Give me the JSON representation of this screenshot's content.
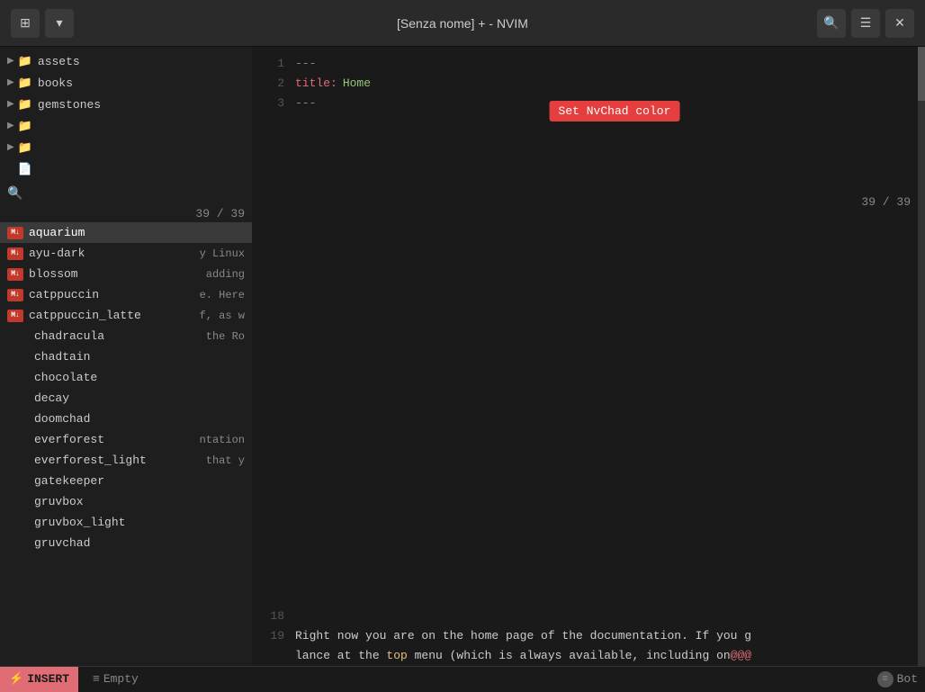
{
  "titlebar": {
    "title": "[Senza nome] + - NVIM",
    "btn_chevron_down": "▾",
    "btn_menu": "☰",
    "btn_search": "🔍",
    "btn_list": "≡",
    "btn_close": "✕"
  },
  "sidebar": {
    "items": [
      {
        "type": "folder",
        "label": "assets",
        "indent": 0
      },
      {
        "type": "folder",
        "label": "books",
        "indent": 0
      },
      {
        "type": "folder",
        "label": "gemstones",
        "indent": 0
      },
      {
        "type": "folder",
        "label": "",
        "indent": 0
      },
      {
        "type": "folder",
        "label": "",
        "indent": 0
      },
      {
        "type": "file",
        "label": "",
        "indent": 0
      }
    ],
    "search_placeholder": "",
    "search_count": "39 / 39"
  },
  "autocomplete": {
    "items": [
      {
        "label": "aquarium",
        "has_icon": true
      },
      {
        "label": "ayu-dark",
        "has_icon": true
      },
      {
        "label": "blossom",
        "has_icon": true
      },
      {
        "label": "catppuccin",
        "has_icon": true
      },
      {
        "label": "catppuccin_latte",
        "has_icon": true
      },
      {
        "label": "chadracula",
        "has_icon": false
      },
      {
        "label": "chadtain",
        "has_icon": false
      },
      {
        "label": "chocolate",
        "has_icon": false
      },
      {
        "label": "decay",
        "has_icon": false
      },
      {
        "label": "doomchad",
        "has_icon": false
      },
      {
        "label": "everforest",
        "has_icon": false
      },
      {
        "label": "everforest_light",
        "has_icon": false
      },
      {
        "label": "gatekeeper",
        "has_icon": false
      },
      {
        "label": "gruvbox",
        "has_icon": false
      },
      {
        "label": "gruvbox_light",
        "has_icon": false
      },
      {
        "label": "gruvchad",
        "has_icon": false
      }
    ]
  },
  "editor": {
    "top_lines": [
      {
        "num": "1",
        "text": "---",
        "type": "dashes"
      },
      {
        "num": "2",
        "key": "title",
        "value": "Home",
        "type": "keyvalue"
      },
      {
        "num": "3",
        "text": "---",
        "type": "dashes"
      }
    ],
    "tooltip": "Set NvChad color",
    "line_count": "39 / 39",
    "bottom_lines": [
      {
        "num": "18",
        "text": ""
      },
      {
        "num": "19",
        "text": "Right now you are on the home page of the documentation. If you g"
      }
    ],
    "continuation": "lance at the top menu (which is always available, including on@@@"
  },
  "right_panel": {
    "partial_texts": [
      "y Linux",
      "adding",
      "e. Here",
      "f, as w",
      "the Ro",
      "ntation",
      "that y"
    ]
  },
  "statusbar": {
    "insert_label": "INSERT",
    "insert_icon": "⚡",
    "empty_icon": "≡",
    "empty_label": "Empty",
    "bot_icon": "≡",
    "bot_label": "Bot"
  }
}
